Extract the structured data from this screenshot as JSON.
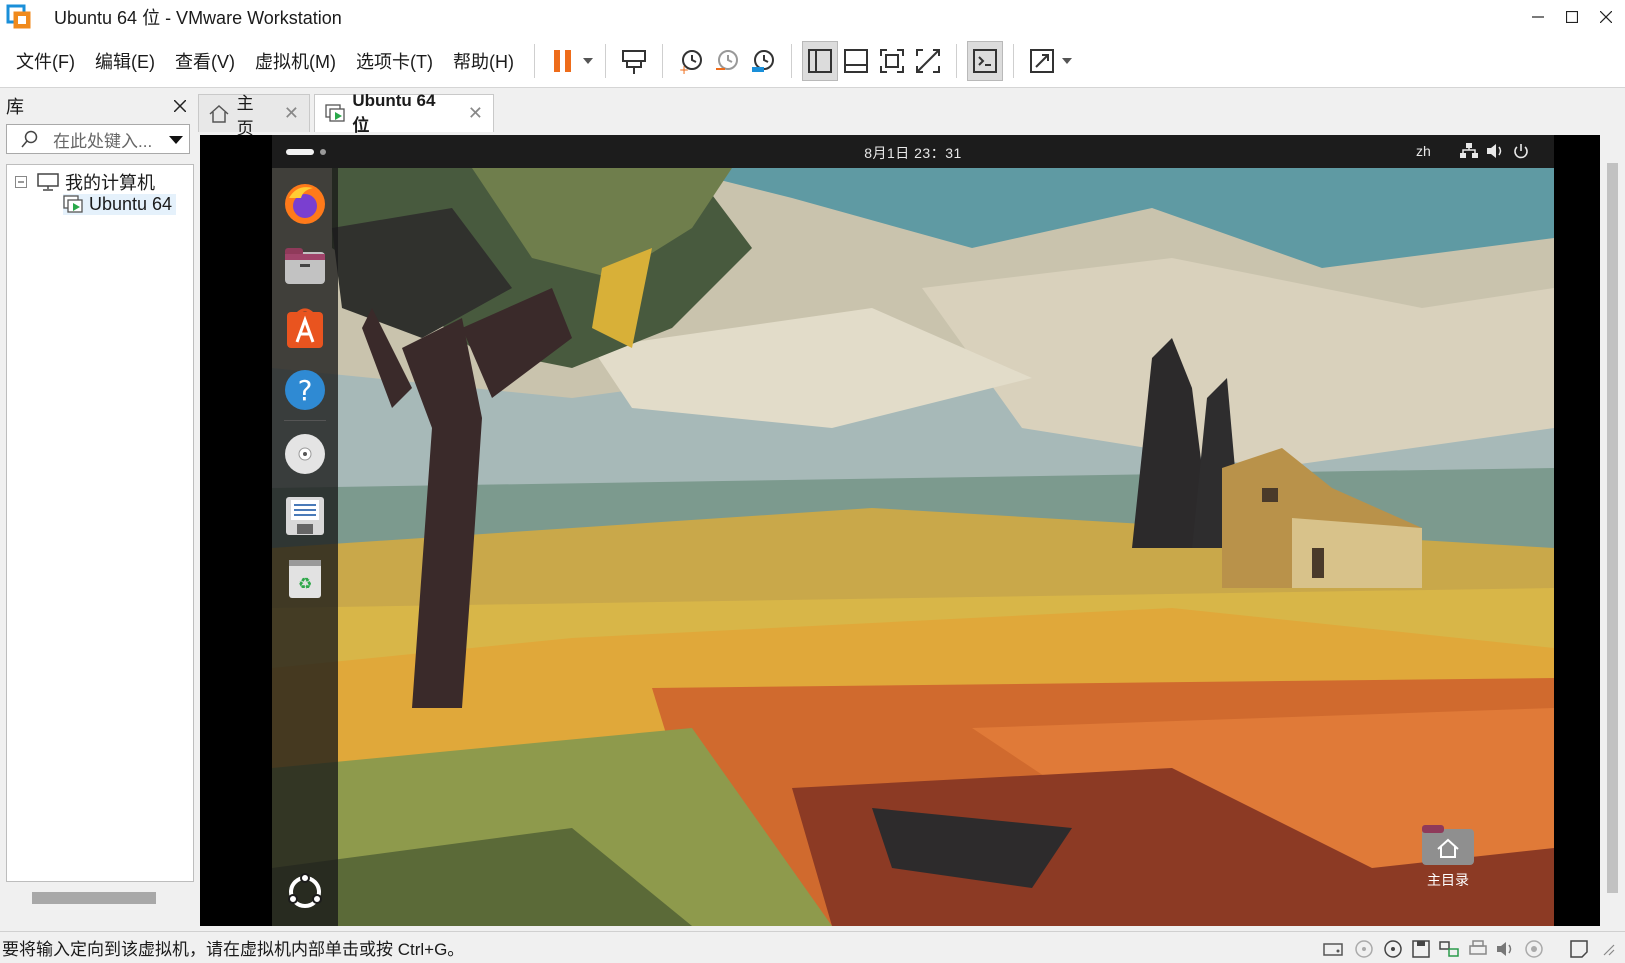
{
  "window": {
    "title": "Ubuntu 64 位 - VMware Workstation"
  },
  "menu": {
    "items": [
      "文件(F)",
      "编辑(E)",
      "查看(V)",
      "虚拟机(M)",
      "选项卡(T)",
      "帮助(H)"
    ]
  },
  "library": {
    "title": "库",
    "search_placeholder": "在此处键入...",
    "tree": {
      "root": "我的计算机",
      "vm": "Ubuntu 64"
    }
  },
  "tabs": [
    {
      "label": "主页"
    },
    {
      "label": "Ubuntu 64 位"
    }
  ],
  "guest": {
    "clock": "8月1日  23：31",
    "lang": "zh",
    "home_folder_label": "主目录"
  },
  "status": {
    "text": "要将输入定向到该虚拟机，请在虚拟机内部单击或按 Ctrl+G。"
  },
  "colors": {
    "pause_accent": "#ee6c1a",
    "vm_icon_green": "#29a84a",
    "panel_bg": "#f0f0f0"
  }
}
